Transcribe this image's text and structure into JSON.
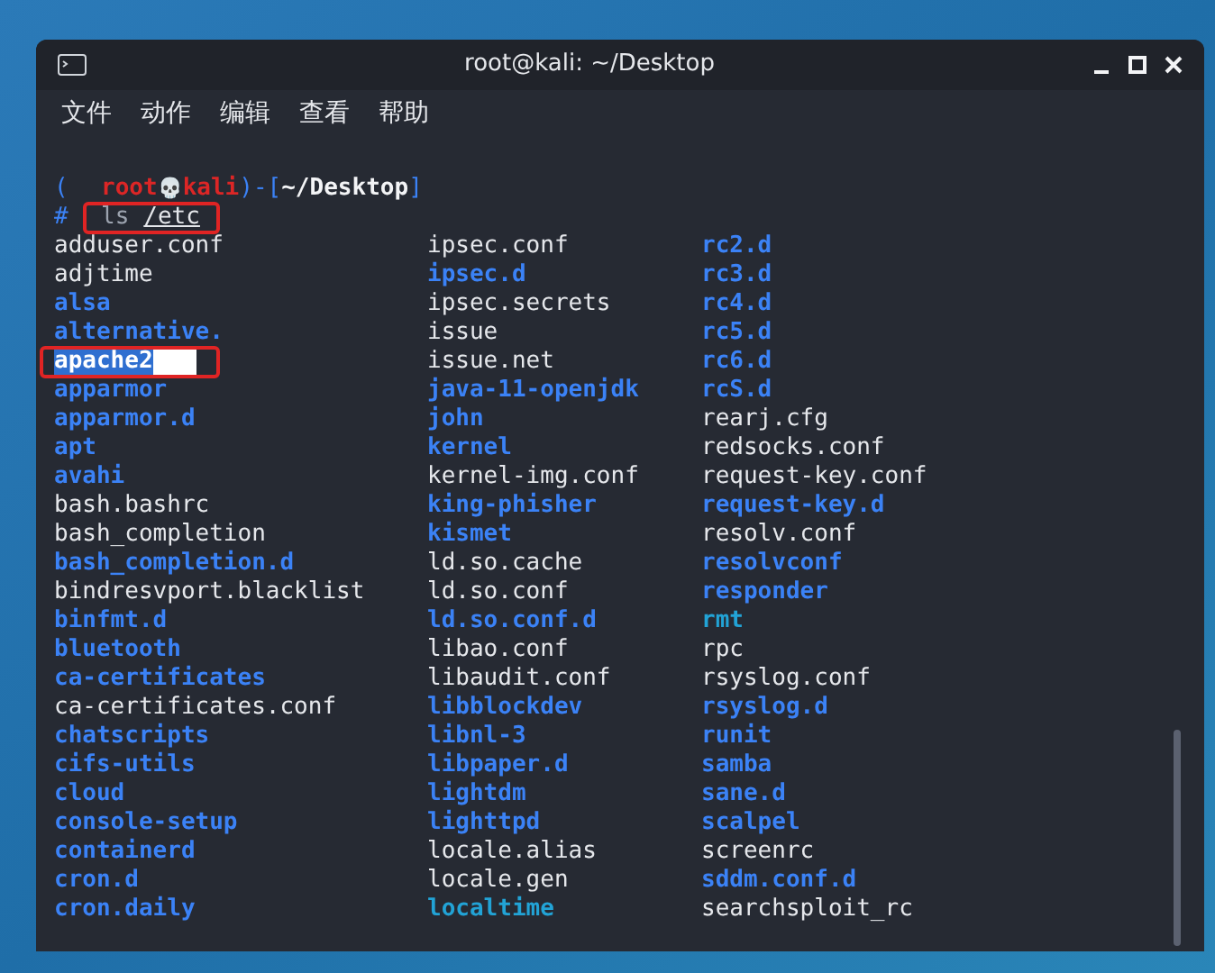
{
  "window": {
    "title": "root@kali: ~/Desktop"
  },
  "menu": [
    "文件",
    "动作",
    "编辑",
    "查看",
    "帮助"
  ],
  "prompt": {
    "open": "(",
    "user": "root",
    "skull": "💀",
    "host": "kali",
    "sep": ")-[",
    "path": "~/Desktop",
    "close": "]",
    "mark": "#",
    "command": "ls",
    "argument": "/etc"
  },
  "columns": [
    [
      {
        "name": "adduser.conf",
        "kind": "file"
      },
      {
        "name": "adjtime",
        "kind": "file"
      },
      {
        "name": "alsa",
        "kind": "dir"
      },
      {
        "name": "alternative.",
        "kind": "dir"
      },
      {
        "name": "apache2",
        "kind": "dir",
        "selected": true
      },
      {
        "name": "apparmor",
        "kind": "dir"
      },
      {
        "name": "apparmor.d",
        "kind": "dir"
      },
      {
        "name": "apt",
        "kind": "dir"
      },
      {
        "name": "avahi",
        "kind": "dir"
      },
      {
        "name": "bash.bashrc",
        "kind": "file"
      },
      {
        "name": "bash_completion",
        "kind": "file"
      },
      {
        "name": "bash_completion.d",
        "kind": "dir"
      },
      {
        "name": "bindresvport.blacklist",
        "kind": "file"
      },
      {
        "name": "binfmt.d",
        "kind": "dir"
      },
      {
        "name": "bluetooth",
        "kind": "dir"
      },
      {
        "name": "ca-certificates",
        "kind": "dir"
      },
      {
        "name": "ca-certificates.conf",
        "kind": "file"
      },
      {
        "name": "chatscripts",
        "kind": "dir"
      },
      {
        "name": "cifs-utils",
        "kind": "dir"
      },
      {
        "name": "cloud",
        "kind": "dir"
      },
      {
        "name": "console-setup",
        "kind": "dir"
      },
      {
        "name": "containerd",
        "kind": "dir"
      },
      {
        "name": "cron.d",
        "kind": "dir"
      },
      {
        "name": "cron.daily",
        "kind": "dir"
      }
    ],
    [
      {
        "name": "ipsec.conf",
        "kind": "file"
      },
      {
        "name": "ipsec.d",
        "kind": "dir"
      },
      {
        "name": "ipsec.secrets",
        "kind": "file"
      },
      {
        "name": "issue",
        "kind": "file"
      },
      {
        "name": "issue.net",
        "kind": "file"
      },
      {
        "name": "java-11-openjdk",
        "kind": "dir"
      },
      {
        "name": "john",
        "kind": "dir"
      },
      {
        "name": "kernel",
        "kind": "dir"
      },
      {
        "name": "kernel-img.conf",
        "kind": "file"
      },
      {
        "name": "king-phisher",
        "kind": "dir"
      },
      {
        "name": "kismet",
        "kind": "dir"
      },
      {
        "name": "ld.so.cache",
        "kind": "file"
      },
      {
        "name": "ld.so.conf",
        "kind": "file"
      },
      {
        "name": "ld.so.conf.d",
        "kind": "dir"
      },
      {
        "name": "libao.conf",
        "kind": "file"
      },
      {
        "name": "libaudit.conf",
        "kind": "file"
      },
      {
        "name": "libblockdev",
        "kind": "dir"
      },
      {
        "name": "libnl-3",
        "kind": "dir"
      },
      {
        "name": "libpaper.d",
        "kind": "dir"
      },
      {
        "name": "lightdm",
        "kind": "dir"
      },
      {
        "name": "lighttpd",
        "kind": "dir"
      },
      {
        "name": "locale.alias",
        "kind": "file"
      },
      {
        "name": "locale.gen",
        "kind": "file"
      },
      {
        "name": "localtime",
        "kind": "link"
      }
    ],
    [
      {
        "name": "rc2.d",
        "kind": "dir"
      },
      {
        "name": "rc3.d",
        "kind": "dir"
      },
      {
        "name": "rc4.d",
        "kind": "dir"
      },
      {
        "name": "rc5.d",
        "kind": "dir"
      },
      {
        "name": "rc6.d",
        "kind": "dir"
      },
      {
        "name": "rcS.d",
        "kind": "dir"
      },
      {
        "name": "rearj.cfg",
        "kind": "file"
      },
      {
        "name": "redsocks.conf",
        "kind": "file"
      },
      {
        "name": "request-key.conf",
        "kind": "file"
      },
      {
        "name": "request-key.d",
        "kind": "dir"
      },
      {
        "name": "resolv.conf",
        "kind": "file"
      },
      {
        "name": "resolvconf",
        "kind": "dir"
      },
      {
        "name": "responder",
        "kind": "dir"
      },
      {
        "name": "rmt",
        "kind": "link"
      },
      {
        "name": "rpc",
        "kind": "file"
      },
      {
        "name": "rsyslog.conf",
        "kind": "file"
      },
      {
        "name": "rsyslog.d",
        "kind": "dir"
      },
      {
        "name": "runit",
        "kind": "dir"
      },
      {
        "name": "samba",
        "kind": "dir"
      },
      {
        "name": "sane.d",
        "kind": "dir"
      },
      {
        "name": "scalpel",
        "kind": "dir"
      },
      {
        "name": "screenrc",
        "kind": "file"
      },
      {
        "name": "sddm.conf.d",
        "kind": "dir"
      },
      {
        "name": "searchsploit_rc",
        "kind": "file"
      }
    ]
  ]
}
